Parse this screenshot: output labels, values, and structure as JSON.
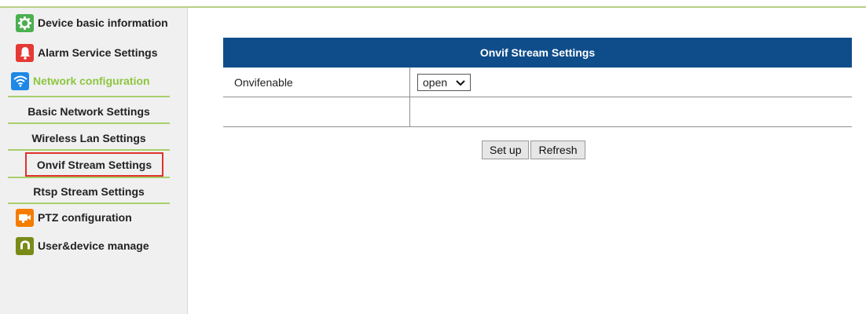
{
  "sidebar": {
    "items": [
      {
        "label": "Device basic information",
        "icon": "gear-icon",
        "color": "#4caf50"
      },
      {
        "label": "Alarm Service Settings",
        "icon": "bell-icon",
        "color": "#e53935"
      },
      {
        "label": "Network configuration",
        "icon": "wifi-icon",
        "color": "#1e88e5"
      },
      {
        "label": "PTZ configuration",
        "icon": "ptz-camera-icon",
        "color": "#f57c00"
      },
      {
        "label": "User&device manage",
        "icon": "user-icon",
        "color": "#7a8a17"
      }
    ],
    "subitems": [
      {
        "label": "Basic Network Settings"
      },
      {
        "label": "Wireless Lan Settings"
      },
      {
        "label": "Onvif Stream Settings"
      },
      {
        "label": "Rtsp Stream Settings"
      }
    ]
  },
  "main": {
    "title": "Onvif Stream Settings",
    "rows": [
      {
        "label": "Onvifenable",
        "value": "open"
      },
      {
        "label": "",
        "value": ""
      }
    ],
    "buttons": {
      "setup": "Set up",
      "refresh": "Refresh"
    }
  },
  "colors": {
    "header": "#0f4d8a",
    "active_nav": "#8dc63f",
    "separator": "#a8cf6b",
    "selected_border": "#e0312b"
  }
}
